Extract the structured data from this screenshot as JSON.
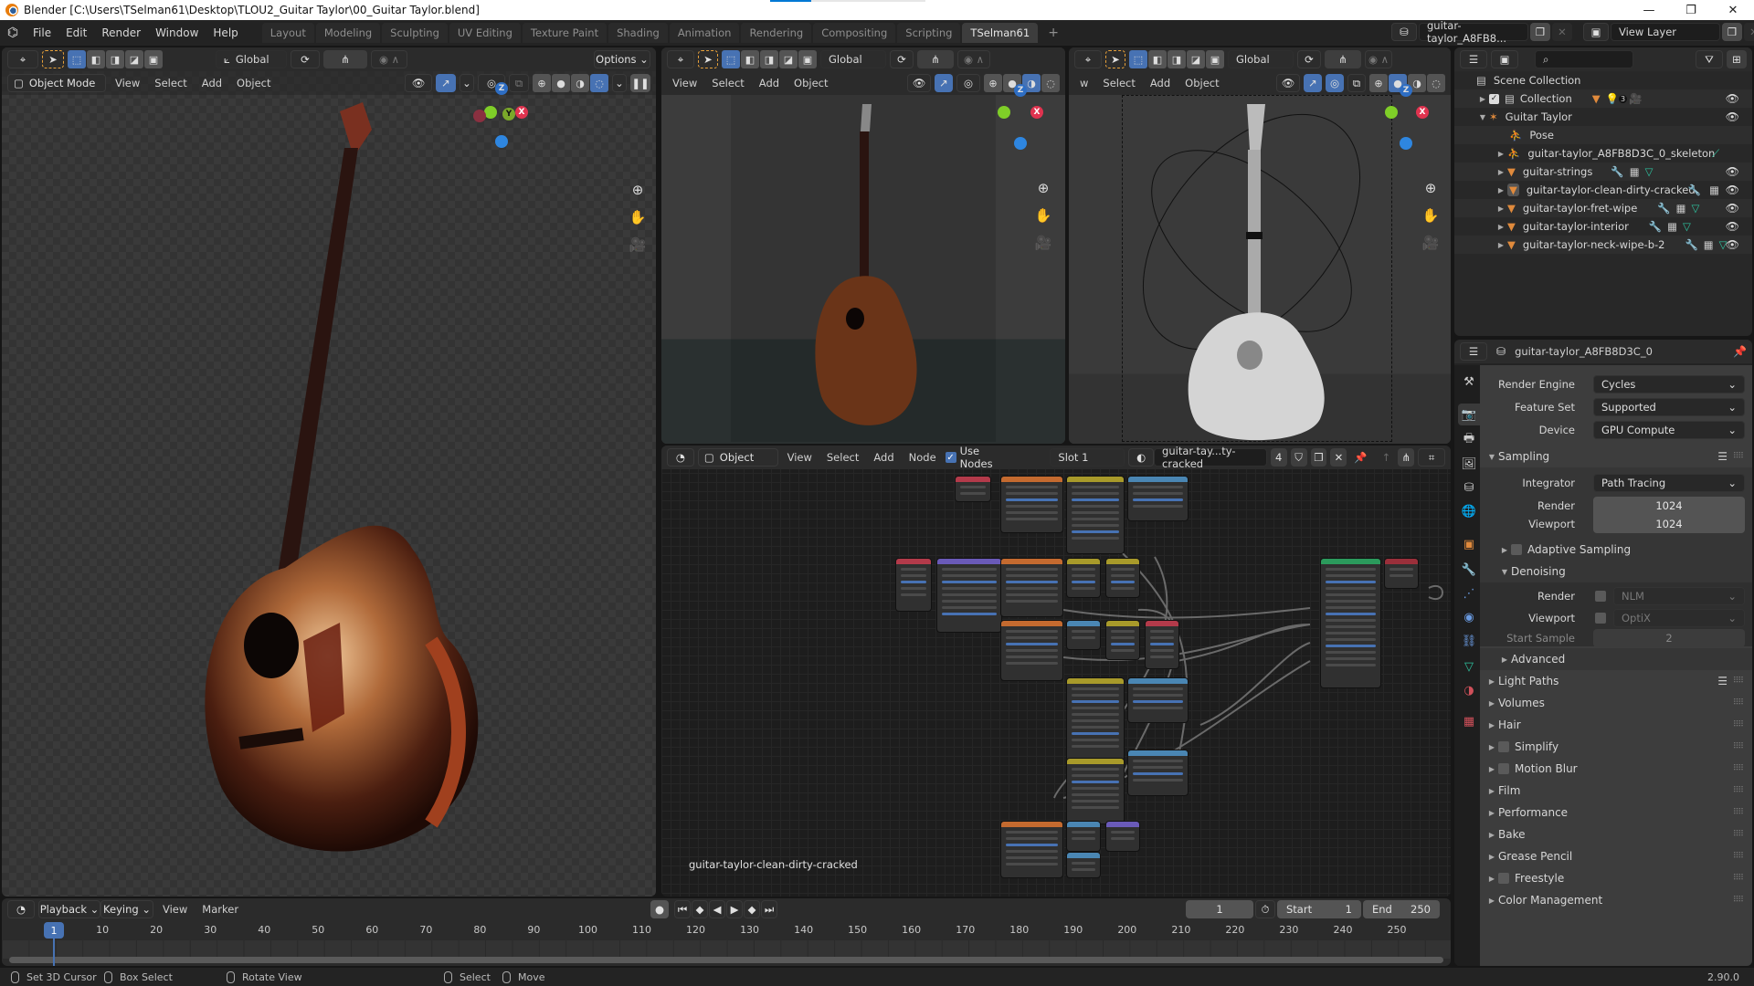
{
  "window": {
    "title": "Blender [C:\\Users\\TSelman61\\Desktop\\TLOU2_Guitar Taylor\\00_Guitar Taylor.blend]",
    "controls": {
      "minimize": "—",
      "maximize": "❐",
      "close": "✕"
    }
  },
  "menubar": {
    "items": [
      "File",
      "Edit",
      "Render",
      "Window",
      "Help"
    ],
    "workspaces": [
      "Layout",
      "Modeling",
      "Sculpting",
      "UV Editing",
      "Texture Paint",
      "Shading",
      "Animation",
      "Rendering",
      "Compositing",
      "Scripting",
      "TSelman61"
    ],
    "active_workspace": "TSelman61",
    "add_workspace": "+",
    "scene_name": "guitar-taylor_A8FB8...",
    "view_layer": "View Layer"
  },
  "viewport_left": {
    "transform_orientation": "Global",
    "options_label": "Options",
    "mode": "Object Mode",
    "menus": [
      "View",
      "Select",
      "Add",
      "Object"
    ],
    "gizmo_labels": {
      "z": "Z",
      "x": "X",
      "y": "Y"
    }
  },
  "viewport_mid": {
    "transform_orientation": "Global",
    "menus": [
      "View",
      "Select",
      "Add",
      "Object"
    ]
  },
  "viewport_right": {
    "transform_orientation": "Global",
    "menus": [
      "w",
      "Select",
      "Add",
      "Object"
    ]
  },
  "node_editor": {
    "editor_type_label": "Object",
    "menus": [
      "View",
      "Select",
      "Add",
      "Node"
    ],
    "use_nodes_label": "Use Nodes",
    "use_nodes_checked": true,
    "slot": "Slot 1",
    "material": "guitar-tay...ty-cracked",
    "user_count": "4",
    "material_label": "guitar-taylor-clean-dirty-cracked",
    "node_colors": {
      "input": "#b33a4a",
      "texture": "#c46a2f",
      "color": "#a89a2a",
      "vector": "#4a86b3",
      "shader": "#2b9a5c",
      "converter": "#6a5ab8",
      "output": "#9a2f3a"
    }
  },
  "outliner": {
    "search_placeholder": "",
    "root": "Scene Collection",
    "items": [
      {
        "name": "Collection",
        "type": "collection",
        "children_count_badge": "3",
        "visible": true
      },
      {
        "name": "Guitar Taylor",
        "type": "armature",
        "visible": true
      },
      {
        "name": "Pose",
        "type": "pose"
      },
      {
        "name": "guitar-taylor_A8FB8D3C_0_skeleton",
        "type": "armature-data"
      },
      {
        "name": "guitar-strings",
        "type": "mesh",
        "visible": true
      },
      {
        "name": "guitar-taylor-clean-dirty-cracked",
        "type": "mesh",
        "visible": true,
        "active": true
      },
      {
        "name": "guitar-taylor-fret-wipe",
        "type": "mesh",
        "visible": true
      },
      {
        "name": "guitar-taylor-interior",
        "type": "mesh",
        "visible": true
      },
      {
        "name": "guitar-taylor-neck-wipe-b-2",
        "type": "mesh",
        "visible": true
      }
    ]
  },
  "properties": {
    "context_name": "guitar-taylor_A8FB8D3C_0",
    "render_engine": {
      "label": "Render Engine",
      "value": "Cycles"
    },
    "feature_set": {
      "label": "Feature Set",
      "value": "Supported"
    },
    "device": {
      "label": "Device",
      "value": "GPU Compute"
    },
    "sampling": {
      "title": "Sampling",
      "integrator": {
        "label": "Integrator",
        "value": "Path Tracing"
      },
      "render": {
        "label": "Render",
        "value": "1024"
      },
      "viewport": {
        "label": "Viewport",
        "value": "1024"
      },
      "adaptive_sampling": "Adaptive Sampling",
      "denoising": {
        "title": "Denoising",
        "render": {
          "label": "Render",
          "value": "NLM"
        },
        "viewport": {
          "label": "Viewport",
          "value": "OptiX"
        },
        "start_sample": {
          "label": "Start Sample",
          "value": "2"
        }
      },
      "advanced": "Advanced"
    },
    "panels": [
      {
        "label": "Light Paths",
        "checkbox": false
      },
      {
        "label": "Volumes",
        "checkbox": false
      },
      {
        "label": "Hair",
        "checkbox": false
      },
      {
        "label": "Simplify",
        "checkbox": true
      },
      {
        "label": "Motion Blur",
        "checkbox": true
      },
      {
        "label": "Film",
        "checkbox": false
      },
      {
        "label": "Performance",
        "checkbox": false
      },
      {
        "label": "Bake",
        "checkbox": false
      },
      {
        "label": "Grease Pencil",
        "checkbox": false
      },
      {
        "label": "Freestyle",
        "checkbox": true
      },
      {
        "label": "Color Management",
        "checkbox": false
      }
    ]
  },
  "timeline": {
    "menus": [
      "Playback",
      "Keying",
      "View",
      "Marker"
    ],
    "current_frame": "1",
    "start_label": "Start",
    "start": "1",
    "end_label": "End",
    "end": "250",
    "ticks": [
      "10",
      "20",
      "30",
      "40",
      "50",
      "60",
      "70",
      "80",
      "90",
      "100",
      "110",
      "120",
      "130",
      "140",
      "150",
      "160",
      "170",
      "180",
      "190",
      "200",
      "210",
      "220",
      "230",
      "240",
      "250"
    ]
  },
  "statusbar": {
    "items": [
      "Set 3D Cursor",
      "Box Select",
      "Rotate View",
      "Select",
      "Move"
    ],
    "version": "2.90.0"
  }
}
